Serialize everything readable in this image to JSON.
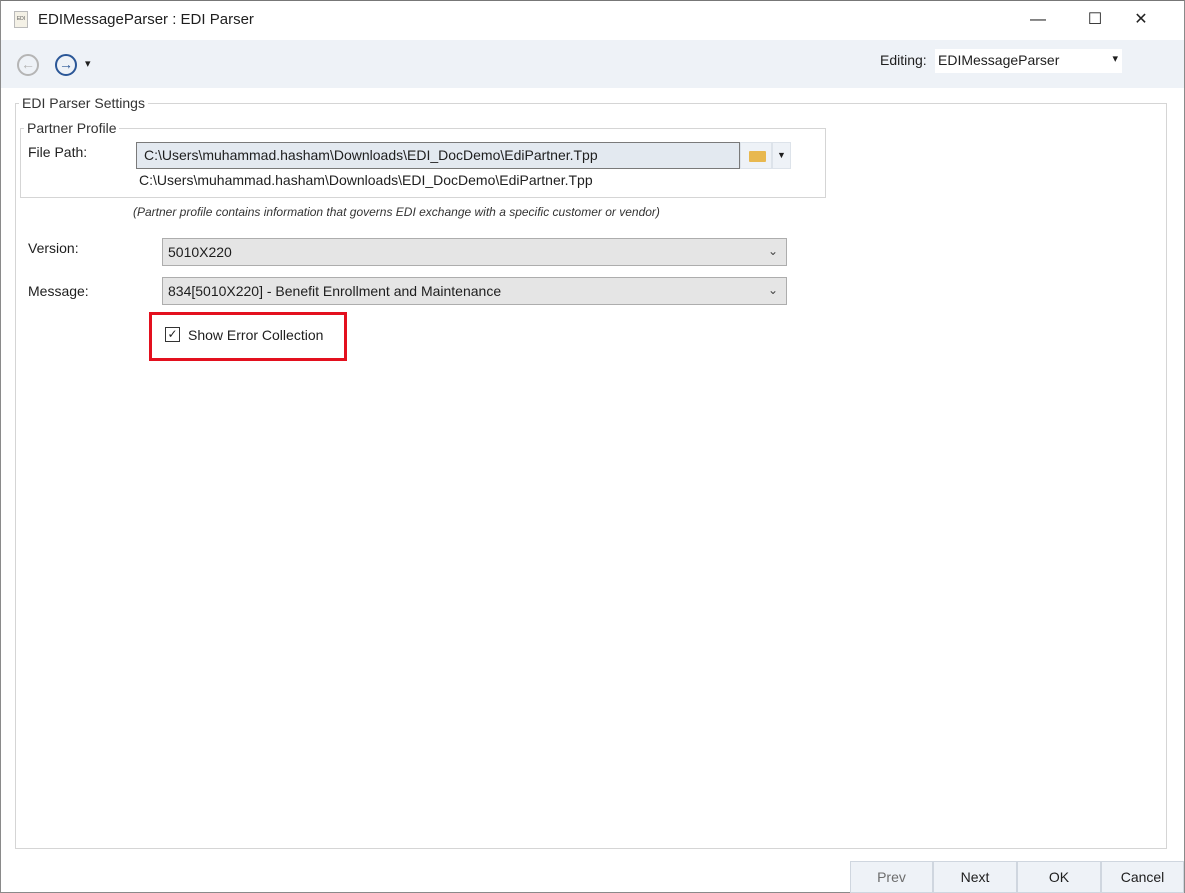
{
  "window": {
    "title": "EDIMessageParser : EDI Parser",
    "app_icon_text": "EDI",
    "minimize": "—",
    "maximize": "☐",
    "close": "✕"
  },
  "toolbar": {
    "back": "←",
    "forward": "→",
    "dropdown": "▾",
    "editing_label": "Editing:",
    "editing_value": "EDIMessageParser",
    "editing_arrow": "▾"
  },
  "settings": {
    "group_title": "EDI Parser Settings",
    "partner_group_title": "Partner Profile",
    "file_path_label": "File Path:",
    "file_path_value": "C:\\Users\\muhammad.hasham\\Downloads\\EDI_DocDemo\\EdiPartner.Tpp",
    "file_path_display": "C:\\Users\\muhammad.hasham\\Downloads\\EDI_DocDemo\\EdiPartner.Tpp",
    "partner_note": "(Partner profile contains information that governs EDI exchange with a specific customer or vendor)",
    "version_label": "Version:",
    "version_value": "5010X220",
    "message_label": "Message:",
    "message_value": "834[5010X220] - Benefit Enrollment and Maintenance",
    "show_error_label": "Show Error Collection",
    "show_error_checked": true,
    "highlight_color": "#e3101e"
  },
  "footer": {
    "prev": "Prev",
    "next": "Next",
    "ok": "OK",
    "cancel": "Cancel"
  }
}
